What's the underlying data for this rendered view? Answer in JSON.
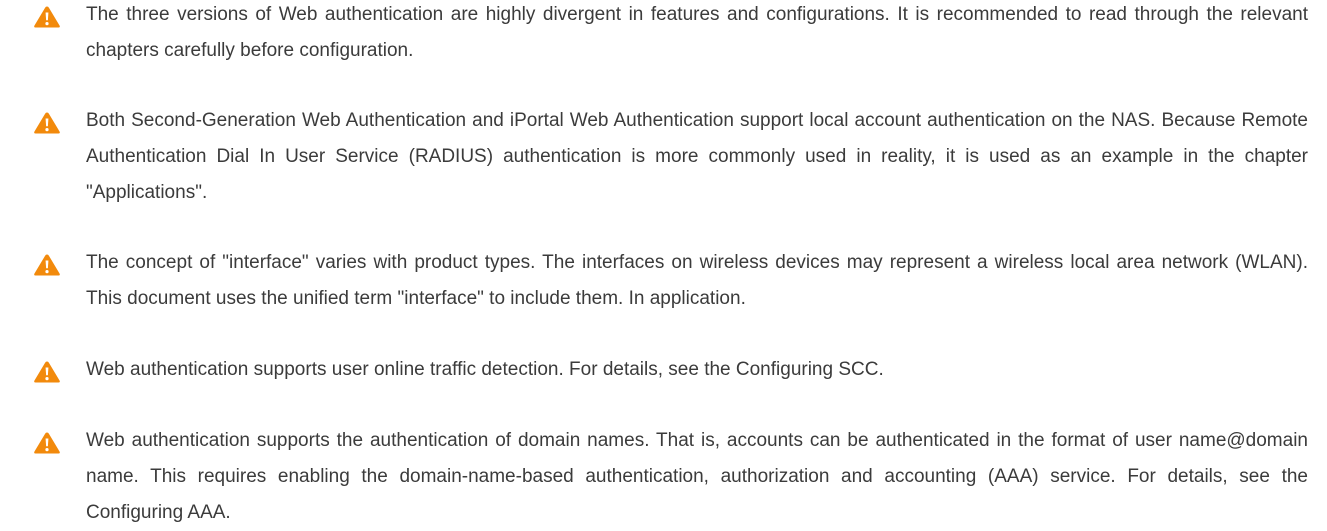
{
  "notes": [
    {
      "icon": "warning-icon",
      "text": "The three versions of Web authentication are highly divergent in features and configurations. It is recommended to read through the relevant chapters carefully before configuration."
    },
    {
      "icon": "warning-icon",
      "text": "Both Second-Generation Web Authentication and iPortal Web Authentication support local account authentication on the NAS. Because Remote Authentication Dial In User Service (RADIUS) authentication is more commonly used in reality, it is used as an example in the chapter \"Applications\"."
    },
    {
      "icon": "warning-icon",
      "text": "The concept of \"interface\" varies with product types. The interfaces on wireless devices may represent a wireless local area network (WLAN). This document uses the unified term \"interface\" to include them. In application."
    },
    {
      "icon": "warning-icon",
      "text": "Web authentication supports user online traffic detection. For details, see the Configuring SCC."
    },
    {
      "icon": "warning-icon",
      "text": "Web authentication supports the authentication of domain names. That is, accounts can be authenticated in the format of user name@domain name. This requires enabling the domain-name-based authentication, authorization and accounting (AAA) service. For details, see the Configuring AAA."
    }
  ],
  "colors": {
    "warning_fill": "#f28a0c",
    "warning_mark": "#ffffff",
    "text": "#3b3b3b"
  }
}
